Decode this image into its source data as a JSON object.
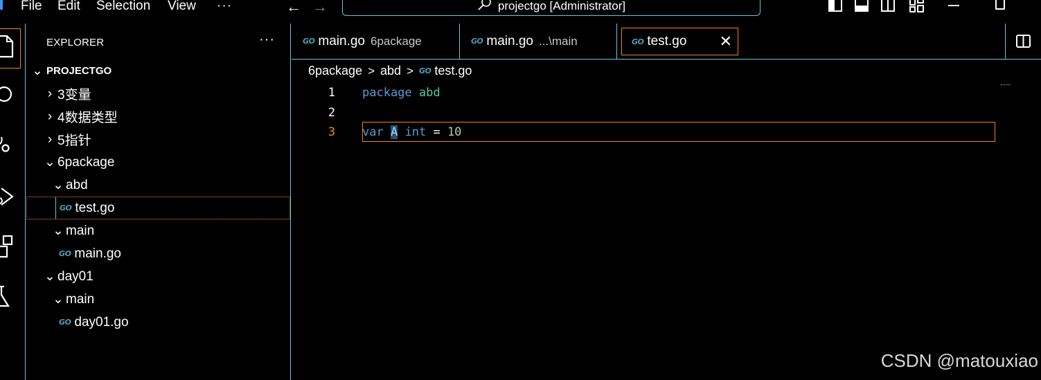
{
  "menu": {
    "file": "File",
    "edit": "Edit",
    "selection": "Selection",
    "view": "View",
    "more": "···"
  },
  "title": {
    "text": "projectgo [Administrator]"
  },
  "sidebar": {
    "header": "EXPLORER",
    "more": "···",
    "root": "PROJECTGO",
    "items": [
      {
        "label": "3变量"
      },
      {
        "label": "4数据类型"
      },
      {
        "label": "5指针"
      },
      {
        "label": "6package"
      },
      {
        "label": "abd"
      },
      {
        "label": "test.go"
      },
      {
        "label": "main"
      },
      {
        "label": "main.go"
      },
      {
        "label": "day01"
      },
      {
        "label": "main"
      },
      {
        "label": "day01.go"
      }
    ],
    "go_icon": "GO"
  },
  "tabs": [
    {
      "name": "main.go",
      "desc": "6package"
    },
    {
      "name": "main.go",
      "desc": "...\\main"
    },
    {
      "name": "test.go",
      "desc": ""
    }
  ],
  "breadcrumb": {
    "folder": "6package",
    "package": "abd",
    "file": "test.go",
    "sep": ">"
  },
  "code": {
    "line_numbers": [
      "1",
      "2",
      "3"
    ],
    "l1_kw": "package",
    "l1_name": "abd",
    "l3_var": "var",
    "l3_ident": "A",
    "l3_type": "int",
    "l3_eq": "=",
    "l3_val": "10"
  },
  "watermark": "CSDN @matouxiao",
  "colors": {
    "accent_border": "#6fc3df",
    "active_outline": "#f38518"
  }
}
